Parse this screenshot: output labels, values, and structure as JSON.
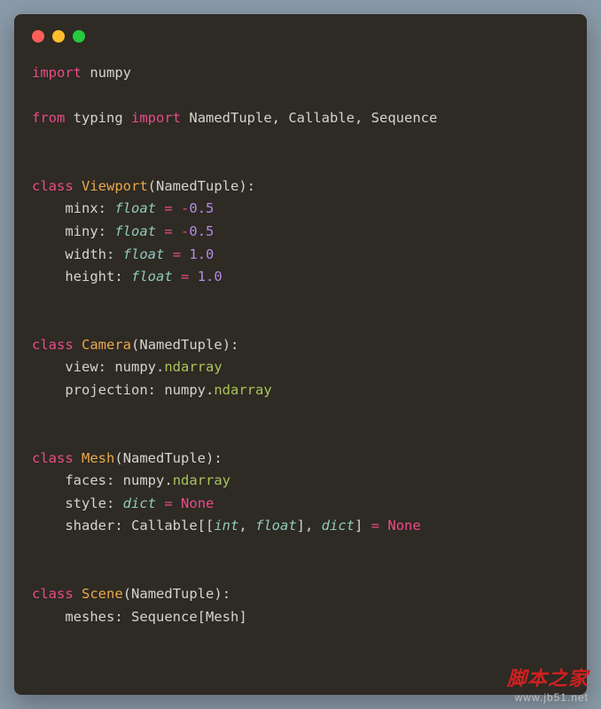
{
  "code": {
    "line1": {
      "import": "import",
      "module": "numpy"
    },
    "line2": {
      "from": "from",
      "module": "typing",
      "import": "import",
      "types": "NamedTuple, Callable, Sequence"
    },
    "viewport": {
      "class_kw": "class",
      "name": "Viewport",
      "base": "NamedTuple",
      "props": {
        "minx": {
          "name": "minx",
          "type": "float",
          "eq": "=",
          "neg": "-",
          "val": "0.5"
        },
        "miny": {
          "name": "miny",
          "type": "float",
          "eq": "=",
          "neg": "-",
          "val": "0.5"
        },
        "width": {
          "name": "width",
          "type": "float",
          "eq": "=",
          "val": "1.0"
        },
        "height": {
          "name": "height",
          "type": "float",
          "eq": "=",
          "val": "1.0"
        }
      }
    },
    "camera": {
      "class_kw": "class",
      "name": "Camera",
      "base": "NamedTuple",
      "props": {
        "view": {
          "name": "view",
          "module": "numpy",
          "attr": "ndarray"
        },
        "projection": {
          "name": "projection",
          "module": "numpy",
          "attr": "ndarray"
        }
      }
    },
    "mesh": {
      "class_kw": "class",
      "name": "Mesh",
      "base": "NamedTuple",
      "props": {
        "faces": {
          "name": "faces",
          "module": "numpy",
          "attr": "ndarray"
        },
        "style": {
          "name": "style",
          "type": "dict",
          "eq": "=",
          "val": "None"
        },
        "shader": {
          "name": "shader",
          "callable": "Callable",
          "int": "int",
          "float": "float",
          "dict": "dict",
          "eq": "=",
          "val": "None"
        }
      }
    },
    "scene": {
      "class_kw": "class",
      "name": "Scene",
      "base": "NamedTuple",
      "props": {
        "meshes": {
          "name": "meshes",
          "seq": "Sequence",
          "type": "Mesh"
        }
      }
    }
  },
  "watermark": {
    "main": "脚本之家",
    "sub": "www.jb51.net"
  }
}
